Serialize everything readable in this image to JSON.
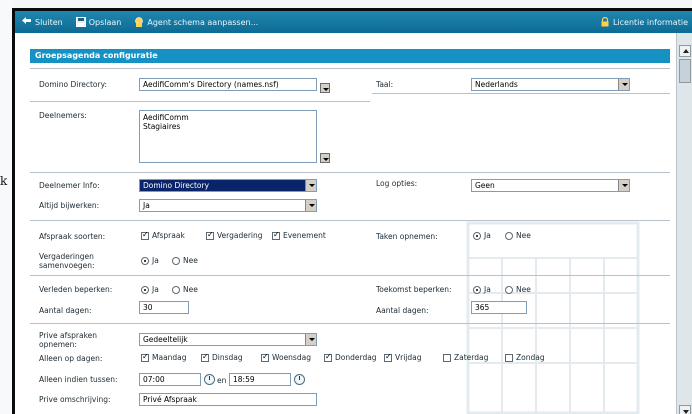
{
  "toolbar": {
    "close": "Sluiten",
    "save": "Opslaan",
    "agent": "Agent schema aanpassen...",
    "license": "Licentie informatie"
  },
  "left_letter": "k",
  "section": {
    "title": "Groepsagenda configuratie"
  },
  "domino_directory": {
    "label": "Domino Directory:",
    "value": "AedifiComm's Directory (names.nsf)"
  },
  "taal": {
    "label": "Taal:",
    "value": "Nederlands"
  },
  "deelnemers": {
    "label": "Deelnemers:",
    "values": [
      "AedifiComm",
      "Stagiaires"
    ]
  },
  "deelnemer_info": {
    "label": "Deelnemer Info:",
    "value": "Domino Directory"
  },
  "log_opties": {
    "label": "Log opties:",
    "value": "Geen"
  },
  "altijd": {
    "label": "Altijd bijwerken:",
    "value": "Ja"
  },
  "afspraak_soorten": {
    "label": "Afspraak soorten:",
    "options": [
      {
        "label": "Afspraak",
        "checked": true
      },
      {
        "label": "Vergadering",
        "checked": true
      },
      {
        "label": "Evenement",
        "checked": true
      }
    ]
  },
  "taken": {
    "label": "Taken opnemen:",
    "yes": "Ja",
    "no": "Nee",
    "selected": "Ja"
  },
  "vergaderingen": {
    "label": "Vergaderingen samenvoegen:",
    "yes": "Ja",
    "no": "Nee",
    "selected": "Ja"
  },
  "verleden": {
    "label": "Verleden beperken:",
    "yes": "Ja",
    "no": "Nee",
    "selected": "Ja"
  },
  "toekomst": {
    "label": "Toekomst beperken:",
    "yes": "Ja",
    "no": "Nee",
    "selected": "Ja"
  },
  "aantal_verleden": {
    "label": "Aantal dagen:",
    "value": "30"
  },
  "aantal_toekomst": {
    "label": "Aantal dagen:",
    "value": "365"
  },
  "prive": {
    "label": "Prive afspraken opnemen:",
    "value": "Gedeeltelijk"
  },
  "dagen": {
    "label": "Alleen op dagen:",
    "options": [
      {
        "label": "Maandag",
        "checked": true
      },
      {
        "label": "Dinsdag",
        "checked": true
      },
      {
        "label": "Woensdag",
        "checked": true
      },
      {
        "label": "Donderdag",
        "checked": true
      },
      {
        "label": "Vrijdag",
        "checked": true
      },
      {
        "label": "Zaterdag",
        "checked": false
      },
      {
        "label": "Zondag",
        "checked": false
      }
    ]
  },
  "tussen": {
    "label": "Alleen indien tussen:",
    "from": "07:00",
    "en": "en",
    "to": "18:59"
  },
  "omschrijving": {
    "label": "Prive omschrijving:",
    "value": "Privé Afspraak"
  },
  "colors": {
    "toolbar": "#1479a3",
    "section": "#1592c3",
    "frame": "#0b0b0b"
  }
}
